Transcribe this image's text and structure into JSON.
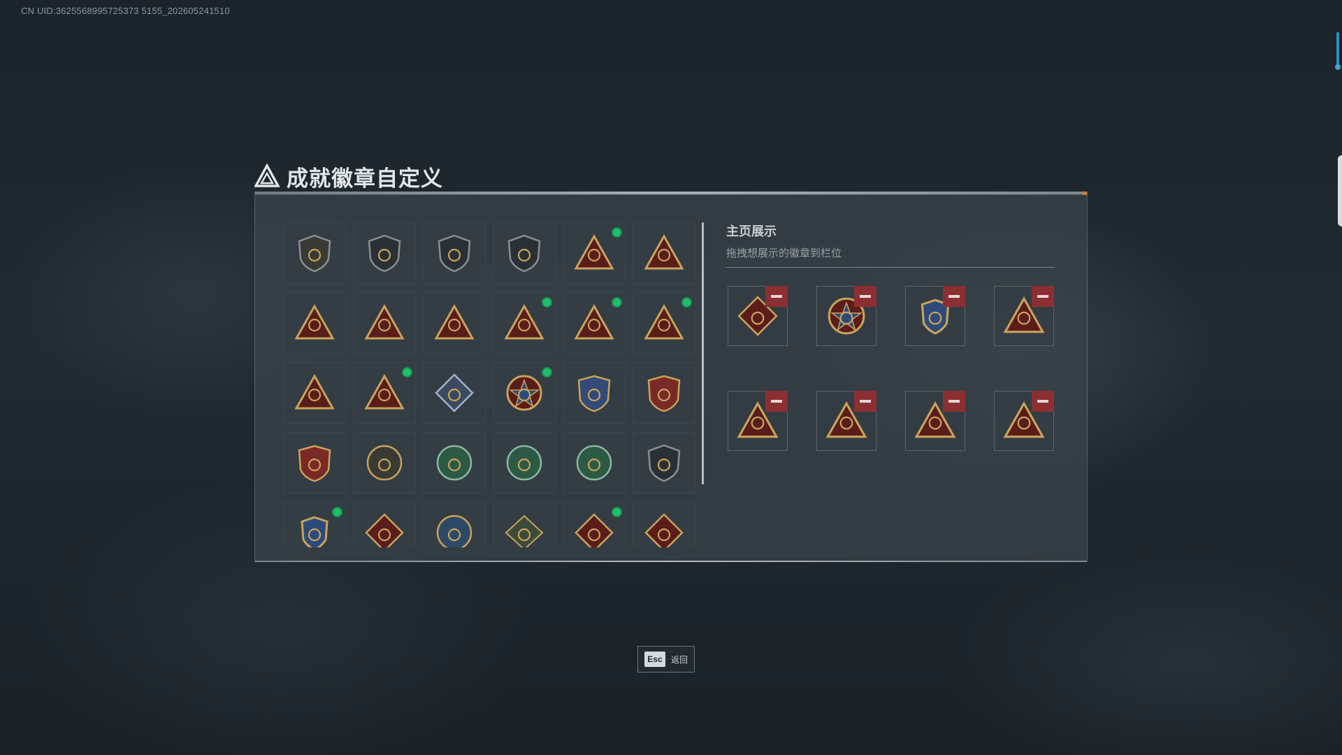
{
  "uid_text": "CN UID:3625568995725373 5155_202605241510",
  "page": {
    "title": "成就徽章自定义",
    "title_icon": "triangle-logo-icon"
  },
  "badges": [
    {
      "icon": "shield-triangle-badge-icon",
      "new": false
    },
    {
      "icon": "shield-helicopter-badge-icon",
      "new": false
    },
    {
      "icon": "shield-diamond-badge-icon",
      "new": false
    },
    {
      "icon": "shield-arrow-badge-icon",
      "new": false
    },
    {
      "icon": "triangle-canister-badge-icon",
      "new": true
    },
    {
      "icon": "triangle-canister-58-badge-icon",
      "new": false
    },
    {
      "icon": "triangle-vehicle-badge-icon",
      "new": false
    },
    {
      "icon": "triangle-helmet-badge-icon",
      "new": false
    },
    {
      "icon": "triangle-number-one-badge-icon",
      "new": false
    },
    {
      "icon": "triangle-block-badge-icon",
      "new": true
    },
    {
      "icon": "triangle-soldier-badge-icon",
      "new": true
    },
    {
      "icon": "triangle-wings-badge-icon",
      "new": true
    },
    {
      "icon": "triangle-figures-badge-icon",
      "new": false
    },
    {
      "icon": "triangle-rocket-badge-icon",
      "new": true
    },
    {
      "icon": "diamond-cube-badge-icon",
      "new": false
    },
    {
      "icon": "star-medal-badge-icon",
      "new": true
    },
    {
      "icon": "blue-crest-badge-icon",
      "new": false
    },
    {
      "icon": "red-crest-badge-icon",
      "new": false
    },
    {
      "icon": "red-shield-crest-badge-icon",
      "new": false
    },
    {
      "icon": "round-target-badge-icon",
      "new": false
    },
    {
      "icon": "green-skull-badge-icon",
      "new": false
    },
    {
      "icon": "green-crosshair-badge-icon",
      "new": false
    },
    {
      "icon": "green-crosshair-shield-badge-icon",
      "new": false
    },
    {
      "icon": "shield-scope-badge-icon",
      "new": false
    },
    {
      "icon": "winged-shield-badge-icon",
      "new": true
    },
    {
      "icon": "wolf-diamond-badge-icon",
      "new": false
    },
    {
      "icon": "eagle-round-badge-icon",
      "new": false
    },
    {
      "icon": "wasp-badge-icon",
      "new": false
    },
    {
      "icon": "dragon-diamond-badge-icon",
      "new": true
    },
    {
      "icon": "runner-diamond-badge-icon",
      "new": false
    }
  ],
  "showcase": {
    "title": "主页展示",
    "hint": "拖拽想展示的徽章到栏位",
    "slots": [
      {
        "icon": "dragon-diamond-badge-icon"
      },
      {
        "icon": "star-medal-badge-icon"
      },
      {
        "icon": "winged-shield-badge-icon"
      },
      {
        "icon": "triangle-canister-badge-icon"
      },
      {
        "icon": "triangle-rocket-badge-icon"
      },
      {
        "icon": "triangle-block-badge-icon"
      },
      {
        "icon": "triangle-wings-badge-icon"
      },
      {
        "icon": "triangle-soldier-badge-icon"
      }
    ]
  },
  "footer": {
    "esc_key": "Esc",
    "esc_label": "返回"
  },
  "colors": {
    "new_dot": "#1fbf6a",
    "remove_button": "#8c2f33",
    "gold": "#c9a35a",
    "dark_red": "#5a1d1a"
  }
}
